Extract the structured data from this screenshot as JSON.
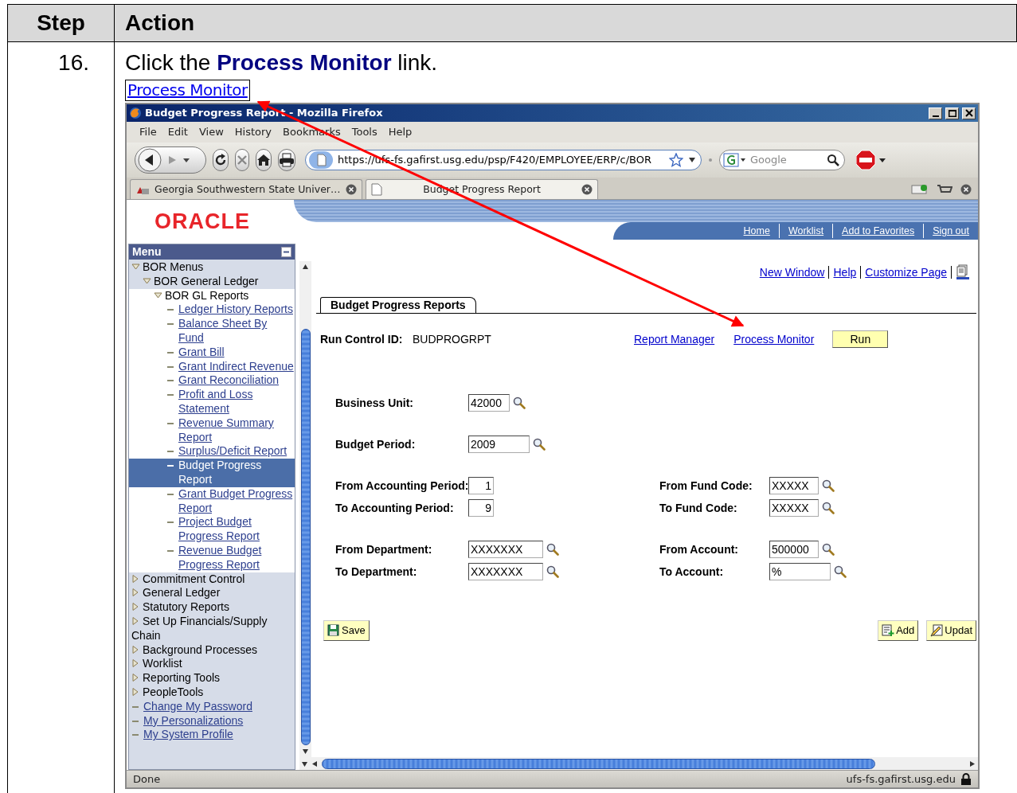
{
  "table": {
    "columns": [
      "Step",
      "Action"
    ],
    "rows": [
      {
        "step": "16.",
        "instruction": "Click the **Process Monitor** link.",
        "link_label": "Process Monitor"
      }
    ]
  },
  "browser": {
    "title": "Budget Progress Report - Mozilla Firefox",
    "menu": [
      "File",
      "Edit",
      "View",
      "History",
      "Bookmarks",
      "Tools",
      "Help"
    ],
    "url": "https://ufs-fs.gafirst.usg.edu/psp/F420/EMPLOYEE/ERP/c/BOR",
    "search_placeholder": "Google",
    "tabs": [
      {
        "label": "Georgia Southwestern State Univer…",
        "selected": false
      },
      {
        "label": "Budget Progress Report",
        "selected": true
      }
    ],
    "status": "Done",
    "status_host": "ufs-fs.gafirst.usg.edu"
  },
  "page": {
    "logo": "ORACLE",
    "nav_links": [
      "Home",
      "Worklist",
      "Add to Favorites",
      "Sign out"
    ],
    "menu": {
      "title": "Menu",
      "items": [
        {
          "label": "BOR Menus",
          "kind": "folder",
          "expanded": true,
          "selected": false,
          "children": [
            {
              "label": "BOR General Ledger",
              "kind": "folder",
              "expanded": true,
              "selected": false,
              "children": [
                {
                  "label": "BOR GL Reports",
                  "kind": "folder",
                  "expanded": true,
                  "selected": false,
                  "children": [
                    {
                      "label": "Ledger History Reports",
                      "kind": "link",
                      "selected": false
                    },
                    {
                      "label": "Balance Sheet By Fund",
                      "kind": "link",
                      "selected": false
                    },
                    {
                      "label": "Grant Bill",
                      "kind": "link",
                      "selected": false
                    },
                    {
                      "label": "Grant Indirect Revenue",
                      "kind": "link",
                      "selected": false
                    },
                    {
                      "label": "Grant Reconciliation",
                      "kind": "link",
                      "selected": false
                    },
                    {
                      "label": "Profit and Loss Statement",
                      "kind": "link",
                      "selected": false
                    },
                    {
                      "label": "Revenue Summary Report",
                      "kind": "link",
                      "selected": false
                    },
                    {
                      "label": "Surplus/Deficit Report",
                      "kind": "link",
                      "selected": false
                    },
                    {
                      "label": "Budget Progress Report",
                      "kind": "link",
                      "selected": true
                    },
                    {
                      "label": "Grant Budget Progress Report",
                      "kind": "link",
                      "selected": false
                    },
                    {
                      "label": "Project Budget Progress Report",
                      "kind": "link",
                      "selected": false
                    },
                    {
                      "label": "Revenue Budget Progress Report",
                      "kind": "link",
                      "selected": false
                    }
                  ]
                }
              ]
            }
          ]
        },
        {
          "label": "Commitment Control",
          "kind": "folder",
          "expanded": false,
          "selected": false
        },
        {
          "label": "General Ledger",
          "kind": "folder",
          "expanded": false,
          "selected": false
        },
        {
          "label": "Statutory Reports",
          "kind": "folder",
          "expanded": false,
          "selected": false
        },
        {
          "label": "Set Up Financials/Supply Chain",
          "kind": "folder",
          "expanded": false,
          "selected": false
        },
        {
          "label": "Background Processes",
          "kind": "folder",
          "expanded": false,
          "selected": false
        },
        {
          "label": "Worklist",
          "kind": "folder",
          "expanded": false,
          "selected": false
        },
        {
          "label": "Reporting Tools",
          "kind": "folder",
          "expanded": false,
          "selected": false
        },
        {
          "label": "PeopleTools",
          "kind": "folder",
          "expanded": false,
          "selected": false
        },
        {
          "label": "Change My Password",
          "kind": "link",
          "selected": false
        },
        {
          "label": "My Personalizations",
          "kind": "link",
          "selected": false
        },
        {
          "label": "My System Profile",
          "kind": "link",
          "selected": false
        }
      ]
    },
    "page_links": [
      "New Window",
      "Help",
      "Customize Page"
    ],
    "tabs": [
      {
        "label": "Budget Progress Reports",
        "selected": true
      }
    ],
    "run_control": {
      "label": "Run Control ID:",
      "value": "BUDPROGRPT"
    },
    "action_links": [
      "Report Manager",
      "Process Monitor"
    ],
    "run_button": "Run",
    "field_groups": [
      [
        [
          {
            "label": "Business Unit:",
            "value": "42000",
            "kind": "lookup"
          }
        ]
      ],
      [
        [
          {
            "label": "Budget Period:",
            "value": "2009",
            "kind": "lookup"
          }
        ]
      ],
      [
        [
          {
            "label": "From Accounting Period:",
            "value": "1",
            "kind": "numeric"
          },
          {
            "label": "From Fund Code:",
            "value": "XXXXX",
            "kind": "lookup"
          }
        ],
        [
          {
            "label": "To Accounting Period:",
            "value": "9",
            "kind": "numeric"
          },
          {
            "label": "To Fund Code:",
            "value": "XXXXX",
            "kind": "lookup"
          }
        ]
      ],
      [
        [
          {
            "label": "From Department:",
            "value": "XXXXXXX",
            "kind": "lookup"
          },
          {
            "label": "From Account:",
            "value": "500000",
            "kind": "lookup"
          }
        ],
        [
          {
            "label": "To Department:",
            "value": "XXXXXXX",
            "kind": "lookup"
          },
          {
            "label": "To Account:",
            "value": "%",
            "kind": "lookup"
          }
        ]
      ]
    ],
    "buttons": [
      {
        "label": "Save",
        "kind": "save"
      },
      {
        "label": "Add",
        "kind": "add"
      },
      {
        "label": "Updat",
        "kind": "update"
      }
    ]
  }
}
